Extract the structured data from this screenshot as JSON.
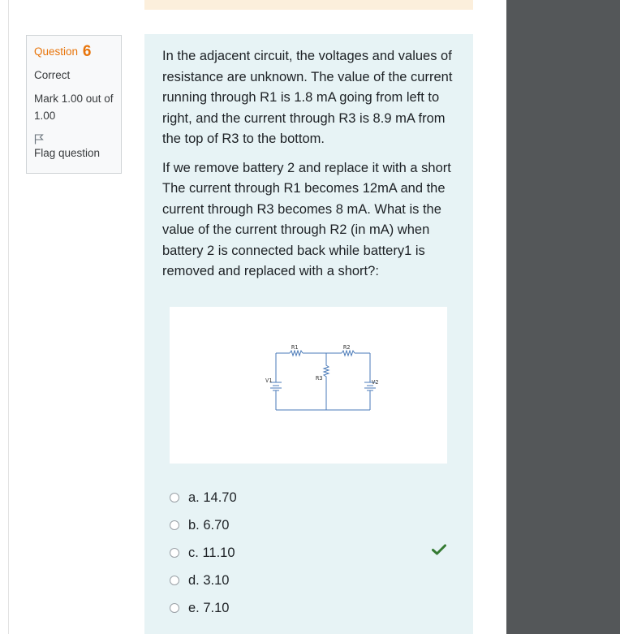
{
  "question": {
    "label": "Question",
    "number": "6",
    "state": "Correct",
    "grade": "Mark 1.00 out of 1.00",
    "flag_label": "Flag question"
  },
  "text": {
    "paragraph1": "In the adjacent circuit, the voltages and values of resistance are unknown. The value of the current running through R1 is 1.8 mA going from left to right, and the current through R3 is 8.9 mA from the top of R3 to the bottom.",
    "paragraph2": "If we remove battery 2 and replace it with a short The current through R1 becomes 12mA and the current through R3 becomes 8 mA. What is the value of the current through R2 (in mA) when battery 2 is connected back while battery1 is removed and replaced with a short?:"
  },
  "circuit": {
    "r1": "R1",
    "r2": "R2",
    "r3": "R3",
    "v1": "V1",
    "v2": "V2"
  },
  "answers": [
    {
      "letter": "a.",
      "value": "14.70",
      "selected": false
    },
    {
      "letter": "b.",
      "value": "6.70",
      "selected": false
    },
    {
      "letter": "c.",
      "value": "11.10",
      "selected": false,
      "correct": true
    },
    {
      "letter": "d.",
      "value": "3.10",
      "selected": false
    },
    {
      "letter": "e.",
      "value": "7.10",
      "selected": false
    }
  ],
  "colors": {
    "accent": "#e8750b",
    "correct": "#357a32",
    "content_bg": "#e7f3f5",
    "sidebar_bg": "#545759",
    "feedback_bg": "#fcefdc"
  }
}
